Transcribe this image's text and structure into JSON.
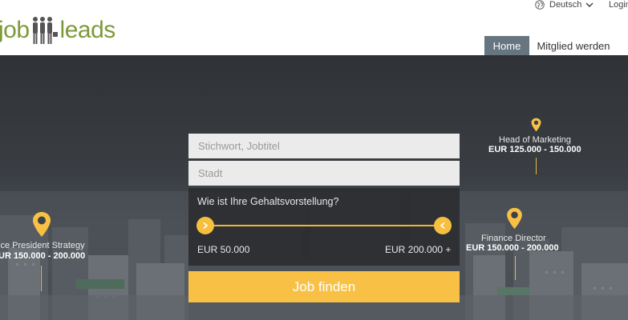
{
  "header": {
    "logo_left": "job",
    "logo_right": "leads",
    "language": "Deutsch",
    "login": "Login",
    "nav": {
      "home": "Home",
      "member": "Mitglied werden"
    }
  },
  "search": {
    "keyword_placeholder": "Stichwort, Jobtitel",
    "city_placeholder": "Stadt",
    "salary_question": "Wie ist Ihre Gehaltsvorstellung?",
    "salary_min": "EUR 50.000",
    "salary_max": "EUR 200.000 +",
    "submit": "Job finden"
  },
  "pins": [
    {
      "title": "ice President Strategy",
      "range": "UR 150.000 - 200.000"
    },
    {
      "title": "Head of Marketing",
      "range": "EUR 125.000 - 150.000"
    },
    {
      "title": "Finance Director",
      "range": "EUR 150.000 - 200.000"
    }
  ],
  "colors": {
    "accent": "#f8c146",
    "logo_green": "#7d9a3a",
    "nav_active": "#667580"
  },
  "icons": [
    "globe-icon",
    "chevron-down-icon",
    "chevron-right-icon",
    "chevron-left-icon",
    "map-pin-icon"
  ]
}
